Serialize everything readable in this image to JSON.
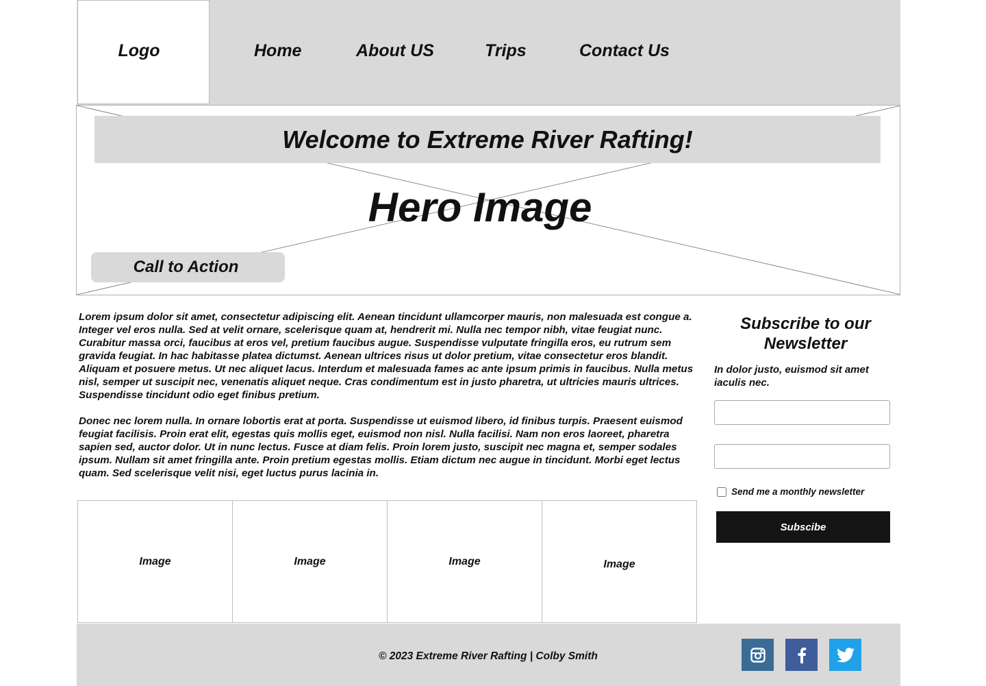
{
  "header": {
    "logo": "Logo",
    "nav": [
      "Home",
      "About US",
      "Trips",
      "Contact Us"
    ]
  },
  "hero": {
    "title": "Welcome to Extreme River Rafting!",
    "placeholder_label": "Hero Image",
    "cta": "Call to Action"
  },
  "content": {
    "paragraphs": [
      "Lorem ipsum dolor sit amet, consectetur adipiscing elit. Aenean tincidunt ullamcorper mauris, non malesuada est congue a. Integer vel eros nulla. Sed at velit ornare, scelerisque quam at, hendrerit mi. Nulla nec tempor nibh, vitae feugiat nunc. Curabitur massa orci, faucibus at eros vel, pretium faucibus augue. Suspendisse vulputate fringilla eros, eu rutrum sem gravida feugiat. In hac habitasse platea dictumst. Aenean ultrices risus ut dolor pretium, vitae consectetur eros blandit. Aliquam et posuere metus. Ut nec aliquet lacus. Interdum et malesuada fames ac ante ipsum primis in faucibus. Nulla metus nisl, semper ut suscipit nec, venenatis aliquet neque. Cras condimentum est in justo pharetra, ut ultricies mauris ultrices. Suspendisse tincidunt odio eget finibus pretium.",
      "Donec nec lorem nulla. In ornare lobortis erat at porta. Suspendisse ut euismod libero, id finibus turpis. Praesent euismod feugiat facilisis. Proin erat elit, egestas quis mollis eget, euismod non nisl. Nulla facilisi. Nam non eros laoreet, pharetra sapien sed, auctor dolor. Ut in nunc lectus. Fusce at diam felis. Proin lorem justo, suscipit nec magna et, semper sodales ipsum. Nullam sit amet fringilla ante. Proin pretium egestas mollis. Etiam dictum nec augue in tincidunt. Morbi eget lectus quam. Sed scelerisque velit nisi, eget luctus purus lacinia in."
    ],
    "images": [
      "Image",
      "Image",
      "Image",
      "Image"
    ]
  },
  "newsletter": {
    "title": "Subscribe to our Newsletter",
    "description": "In dolor justo, euismod sit amet iaculis nec.",
    "field1_value": "",
    "field2_value": "",
    "checkbox_label": "Send me a monthly newsletter",
    "checkbox_checked": false,
    "button": "Subscibe"
  },
  "footer": {
    "copyright": "© 2023 Extreme River Rafting | Colby Smith",
    "social": [
      {
        "name": "instagram-icon",
        "color": "#3b6c96"
      },
      {
        "name": "facebook-icon",
        "color": "#3f5d9a"
      },
      {
        "name": "twitter-icon",
        "color": "#21a1e8"
      }
    ]
  }
}
